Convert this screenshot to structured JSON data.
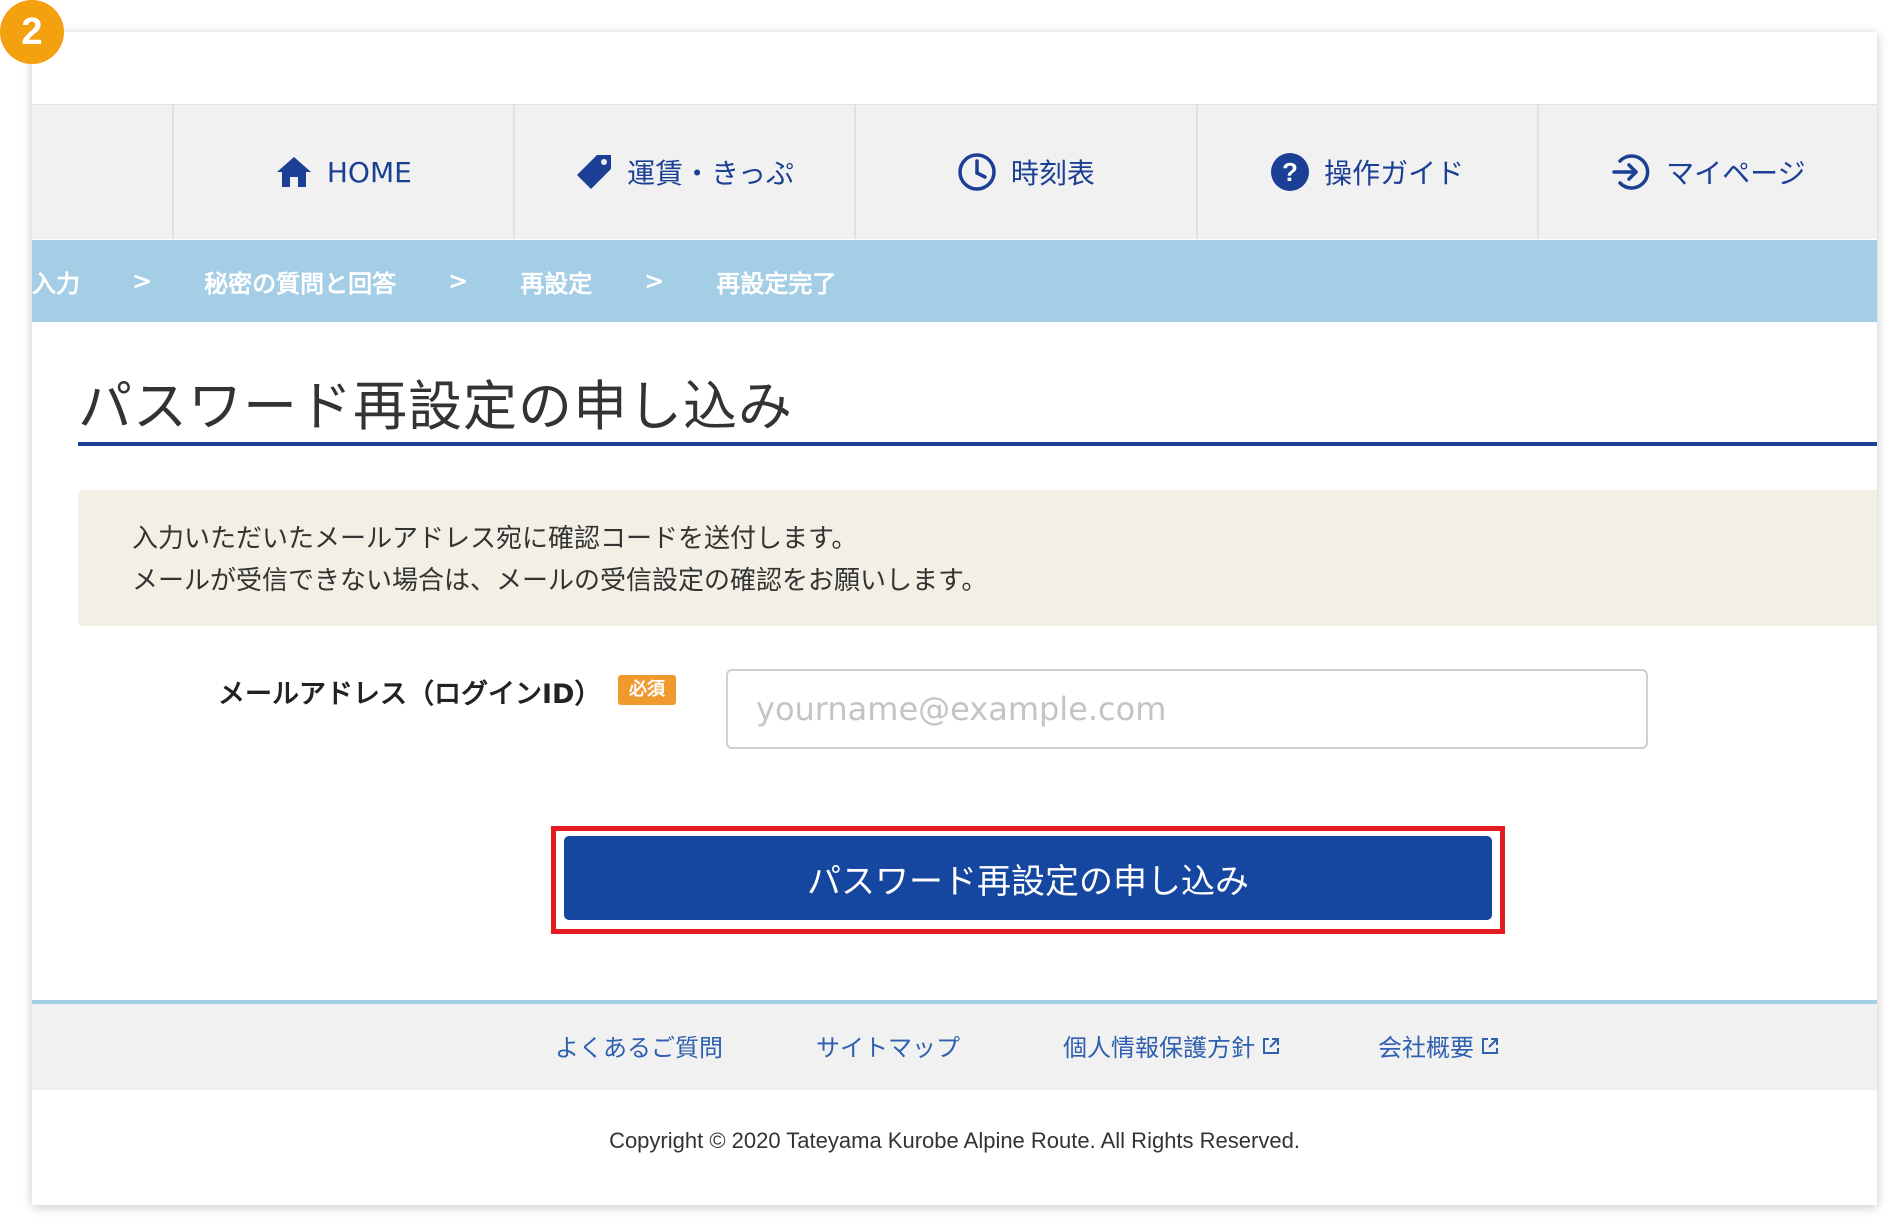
{
  "step_number": "2",
  "nav": {
    "items": [
      {
        "label": "HOME",
        "icon": "home-icon"
      },
      {
        "label": "運賃・きっぷ",
        "icon": "ticket-tag-icon"
      },
      {
        "label": "時刻表",
        "icon": "clock-icon"
      },
      {
        "label": "操作ガイド",
        "icon": "help-icon"
      },
      {
        "label": "マイページ",
        "icon": "login-arrow-icon"
      }
    ]
  },
  "breadcrumb": {
    "items": [
      "入力",
      "秘密の質問と回答",
      "再設定",
      "再設定完了"
    ],
    "separator": ">"
  },
  "page": {
    "title": "パスワード再設定の申し込み"
  },
  "notice": {
    "line1": "入力いただいたメールアドレス宛に確認コードを送付します。",
    "line2": "メールが受信できない場合は、メールの受信設定の確認をお願いします。"
  },
  "form": {
    "email_label": "メールアドレス（ログインID）",
    "required_badge": "必須",
    "email_placeholder": "yourname@example.com",
    "email_value": "",
    "submit_label": "パスワード再設定の申し込み"
  },
  "footer": {
    "links": [
      {
        "label": "よくあるご質問",
        "external": false
      },
      {
        "label": "サイトマップ",
        "external": false
      },
      {
        "label": "個人情報保護方針",
        "external": true
      },
      {
        "label": "会社概要",
        "external": true
      }
    ],
    "copyright": "Copyright © 2020 Tateyama Kurobe Alpine Route. All Rights Reserved."
  },
  "colors": {
    "step_badge": "#f4a10f",
    "primary_blue": "#1546a0",
    "breadcrumb_bg": "#a4cde6",
    "highlight_red": "#e31b23",
    "required_orange": "#f0992d",
    "notice_bg": "#f2efe4"
  }
}
